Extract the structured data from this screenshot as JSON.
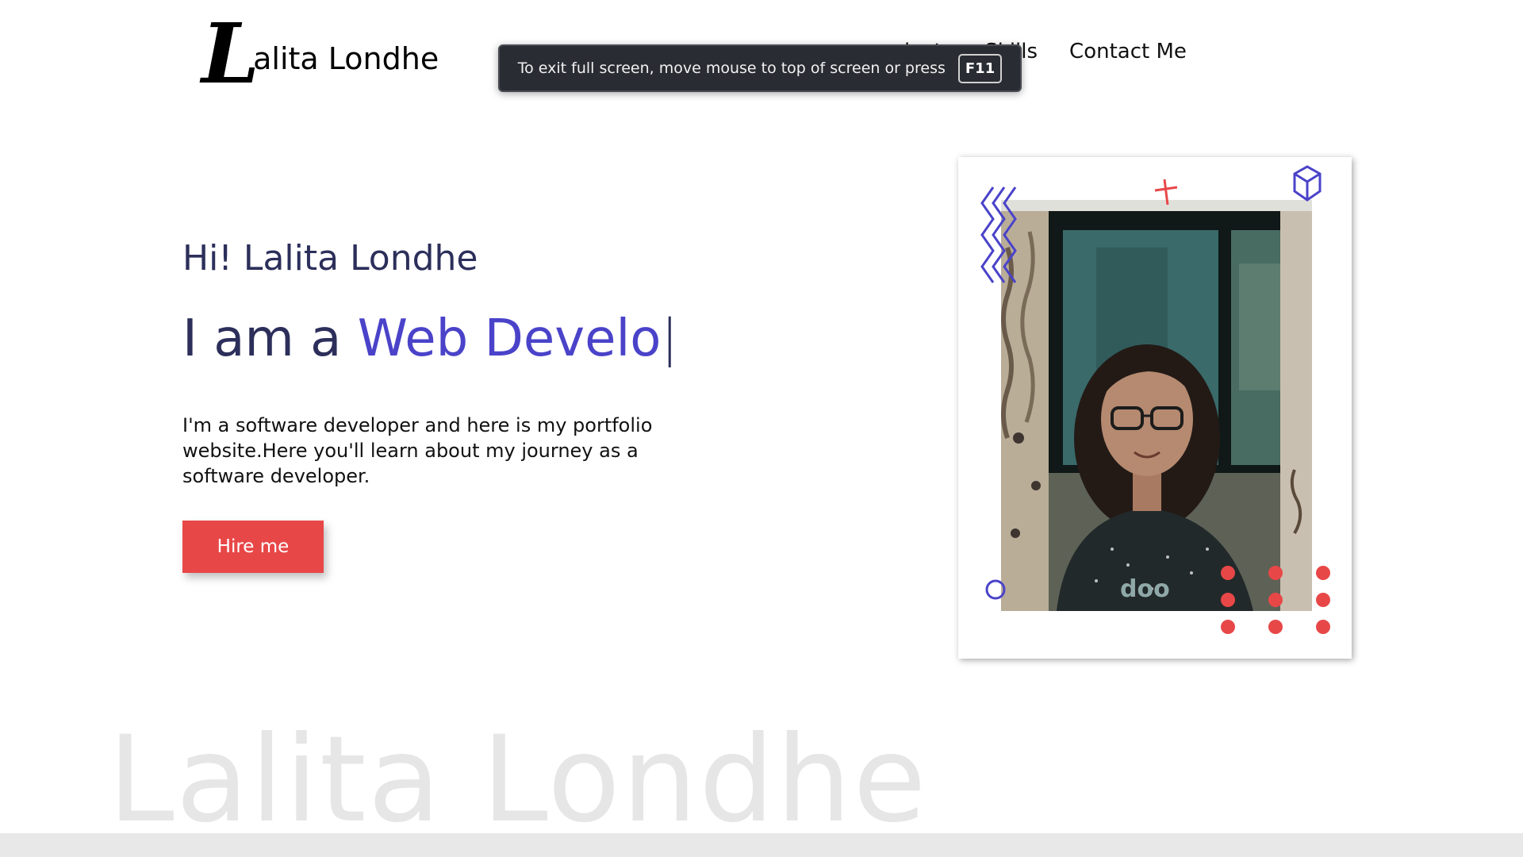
{
  "logo": {
    "letter": "L",
    "rest": "alita Londhe"
  },
  "nav": {
    "items": [
      {
        "label": "jects"
      },
      {
        "label": "Skills"
      },
      {
        "label": "Contact Me"
      }
    ]
  },
  "fullscreen_toast": {
    "message": "To exit full screen, move mouse to top of screen or press",
    "key": "F11"
  },
  "hero": {
    "greeting": "Hi! Lalita Londhe",
    "tagline_prefix": "I am a",
    "tagline_role": "Web Develo",
    "cursor": "|",
    "intro": "I'm a software developer and here is my portfolio website.Here you'll learn about my journey as a software developer.",
    "hire_button": "Hire me"
  },
  "watermark": "Lalita Londhe",
  "colors": {
    "accent_red": "#e84748",
    "accent_purple": "#4a43c9",
    "heading_navy": "#2c2f5a"
  }
}
